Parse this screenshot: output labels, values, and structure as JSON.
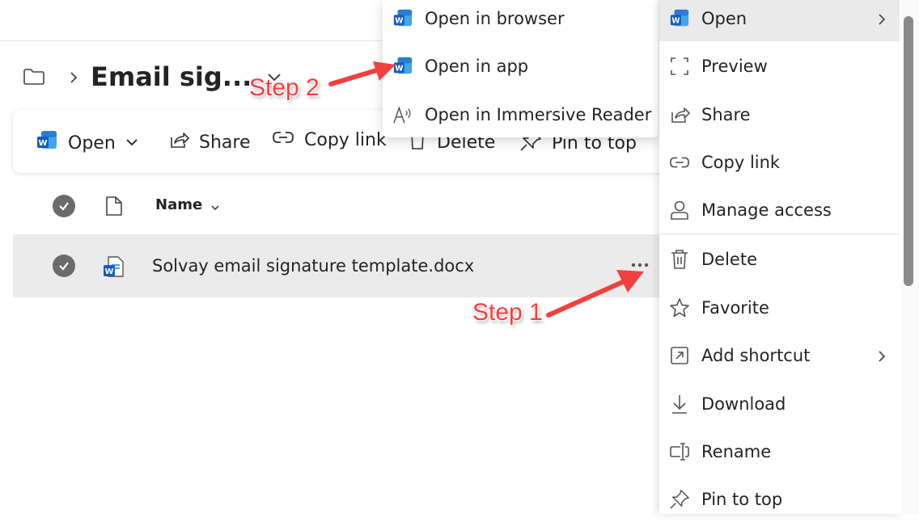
{
  "breadcrumb": {
    "title": "Email sig..."
  },
  "command_bar": {
    "open": "Open",
    "share": "Share",
    "copy_link": "Copy link",
    "delete": "Delete",
    "pin_to_top": "Pin to top"
  },
  "list": {
    "column_name": "Name",
    "rows": [
      {
        "name": "Solvay email signature template.docx"
      }
    ]
  },
  "open_submenu": {
    "items": [
      {
        "label": "Open in browser",
        "icon": "word-icon"
      },
      {
        "label": "Open in app",
        "icon": "word-icon"
      },
      {
        "label": "Open in Immersive Reader",
        "icon": "immersive-reader-icon"
      }
    ]
  },
  "context_menu": {
    "items": [
      {
        "label": "Open",
        "icon": "word-icon",
        "has_submenu": true
      },
      {
        "label": "Preview",
        "icon": "preview-icon"
      },
      {
        "label": "Share",
        "icon": "share-icon"
      },
      {
        "label": "Copy link",
        "icon": "link-icon"
      },
      {
        "label": "Manage access",
        "icon": "person-icon"
      },
      {
        "label": "Delete",
        "icon": "trash-icon"
      },
      {
        "label": "Favorite",
        "icon": "star-icon"
      },
      {
        "label": "Add shortcut",
        "icon": "shortcut-icon",
        "has_submenu": true
      },
      {
        "label": "Download",
        "icon": "download-icon"
      },
      {
        "label": "Rename",
        "icon": "rename-icon"
      },
      {
        "label": "Pin to top",
        "icon": "pin-icon"
      }
    ]
  },
  "annotations": {
    "step1": "Step 1",
    "step2": "Step 2"
  },
  "colors": {
    "word_blue": "#185abd",
    "annotation_red": "#ff3b3b",
    "hover_gray": "#eaeaea"
  }
}
